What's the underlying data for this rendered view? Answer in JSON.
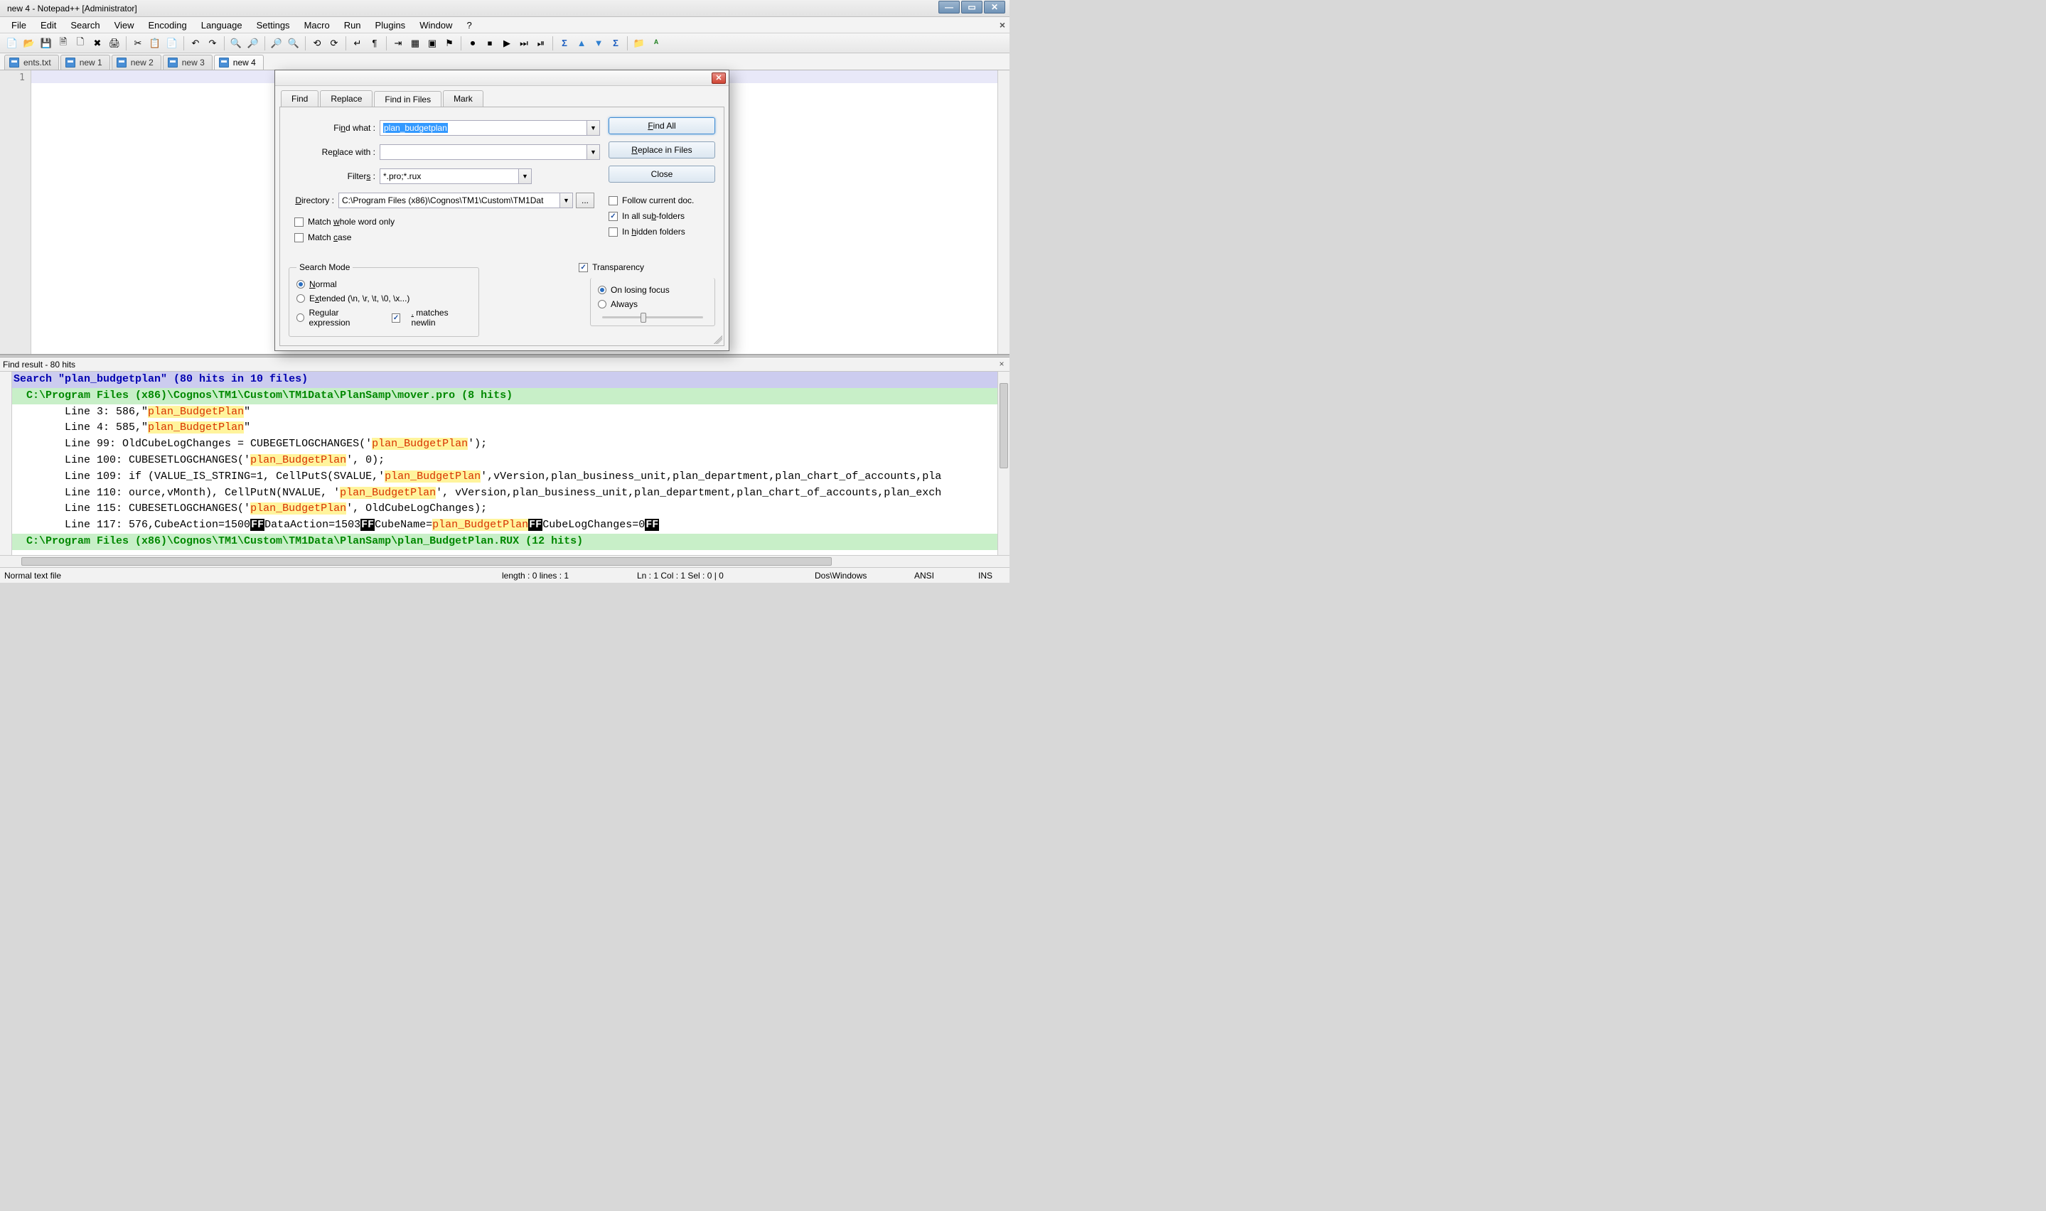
{
  "title": "new 4 - Notepad++ [Administrator]",
  "menu": [
    "File",
    "Edit",
    "Search",
    "View",
    "Encoding",
    "Language",
    "Settings",
    "Macro",
    "Run",
    "Plugins",
    "Window",
    "?"
  ],
  "tabs": [
    {
      "label": "ents.txt",
      "active": false
    },
    {
      "label": "new 1",
      "active": false
    },
    {
      "label": "new 2",
      "active": false
    },
    {
      "label": "new 3",
      "active": false
    },
    {
      "label": "new 4",
      "active": true
    }
  ],
  "editor": {
    "gutter_line": "1"
  },
  "find_header": "Find result - 80 hits",
  "find_results": {
    "search_line": "Search \"plan_budgetplan\" (80 hits in 10 files)",
    "file1": "  C:\\Program Files (x86)\\Cognos\\TM1\\Custom\\TM1Data\\PlanSamp\\mover.pro (8 hits)",
    "lines": [
      {
        "pre": "\tLine 3: 586,\"",
        "match": "plan_BudgetPlan",
        "post": "\""
      },
      {
        "pre": "\tLine 4: 585,\"",
        "match": "plan_BudgetPlan",
        "post": "\""
      },
      {
        "pre": "\tLine 99: OldCubeLogChanges = CUBEGETLOGCHANGES('",
        "match": "plan_BudgetPlan",
        "post": "');"
      },
      {
        "pre": "\tLine 100: CUBESETLOGCHANGES('",
        "match": "plan_BudgetPlan",
        "post": "', 0);"
      },
      {
        "pre": "\tLine 109: if (VALUE_IS_STRING=1, CellPutS(SVALUE,'",
        "match": "plan_BudgetPlan",
        "post": "',vVersion,plan_business_unit,plan_department,plan_chart_of_accounts,pla"
      },
      {
        "pre": "\tLine 110: ource,vMonth), CellPutN(NVALUE, '",
        "match": "plan_BudgetPlan",
        "post": "', vVersion,plan_business_unit,plan_department,plan_chart_of_accounts,plan_exch"
      },
      {
        "pre": "\tLine 115: CUBESETLOGCHANGES('",
        "match": "plan_BudgetPlan",
        "post": "', OldCubeLogChanges);"
      }
    ],
    "line117": {
      "pre": "\tLine 117: 576,CubeAction=1500",
      "ff1": "FF",
      "mid1": "DataAction=1503",
      "ff2": "FF",
      "mid2": "CubeName=",
      "match": "plan_BudgetPlan",
      "ff3": "FF",
      "post": "CubeLogChanges=0",
      "ff4": "FF"
    },
    "file2": "  C:\\Program Files (x86)\\Cognos\\TM1\\Custom\\TM1Data\\PlanSamp\\plan_BudgetPlan.RUX (12 hits)"
  },
  "statusbar": {
    "left": "Normal text file",
    "length": "length : 0    lines : 1",
    "pos": "Ln : 1    Col : 1    Sel : 0 | 0",
    "eol": "Dos\\Windows",
    "enc": "ANSI",
    "ins": "INS"
  },
  "dialog": {
    "tabs": [
      "Find",
      "Replace",
      "Find in Files",
      "Mark"
    ],
    "labels": {
      "find_what": "Find what :",
      "replace_with": "Replace with :",
      "filters": "Filters :",
      "directory": "Directory :"
    },
    "find_what_value": "plan_budgetplan",
    "replace_with_value": "",
    "filters_value": "*.pro;*.rux",
    "directory_value": "C:\\Program Files (x86)\\Cognos\\TM1\\Custom\\TM1Dat",
    "buttons": {
      "find_all": "Find All",
      "replace_in_files": "Replace in Files",
      "close": "Close"
    },
    "checkboxes": {
      "match_whole": "Match whole word only",
      "match_case": "Match case",
      "follow_current": "Follow current doc.",
      "in_subfolders": "In all sub-folders",
      "in_hidden": "In hidden folders",
      "dot_newline": ". matches newlin"
    },
    "search_mode_legend": "Search Mode",
    "radios": {
      "normal": "Normal",
      "extended": "Extended (\\n, \\r, \\t, \\0, \\x...)",
      "regex": "Regular expression"
    },
    "transparency_legend": "Transparency",
    "trans_radios": {
      "on_losing": "On losing focus",
      "always": "Always"
    }
  },
  "toolbar_icons": [
    "📄",
    "📂",
    "💾",
    "📑",
    "🖫",
    "✖",
    "🖨",
    "",
    "✂",
    "📋",
    "📄",
    "↶",
    "↷",
    "",
    "🔍",
    "🔎",
    "",
    "🔃",
    "⟲",
    "",
    "▦",
    "▧",
    "",
    "🔤",
    "",
    "⬛",
    "⬛",
    "⬛",
    "⬛",
    "",
    "⏺",
    "⏹",
    "⏵",
    "⏭",
    "⏯",
    "",
    "Σ",
    "▲",
    "▼",
    "Σ",
    "",
    "📁",
    "ᴬ"
  ]
}
